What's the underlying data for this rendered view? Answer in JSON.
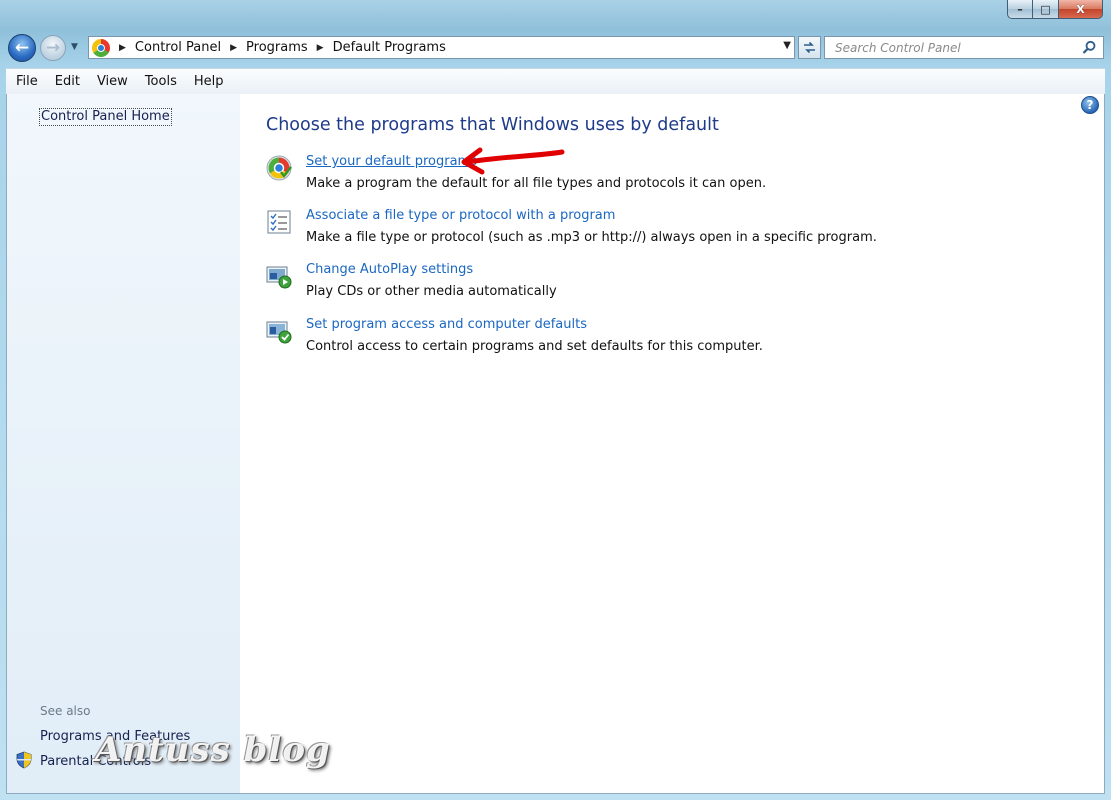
{
  "window": {
    "caption": {
      "minimize": "–",
      "maximize": "□",
      "close": "X"
    }
  },
  "address_bar": {
    "breadcrumbs": [
      "Control Panel",
      "Programs",
      "Default Programs"
    ]
  },
  "search": {
    "placeholder": "Search Control Panel"
  },
  "menu": [
    "File",
    "Edit",
    "View",
    "Tools",
    "Help"
  ],
  "sidebar": {
    "home_link": "Control Panel Home",
    "see_also_label": "See also",
    "links": [
      "Programs and Features",
      "Parental Controls"
    ]
  },
  "main": {
    "heading": "Choose the programs that Windows uses by default",
    "tasks": [
      {
        "icon": "default-programs-icon",
        "link": "Set your default programs",
        "desc": "Make a program the default for all file types and protocols it can open."
      },
      {
        "icon": "file-association-icon",
        "link": "Associate a file type or protocol with a program",
        "desc": "Make a file type or protocol (such as .mp3 or http://) always open in a specific program."
      },
      {
        "icon": "autoplay-icon",
        "link": "Change AutoPlay settings",
        "desc": "Play CDs or other media automatically"
      },
      {
        "icon": "program-access-icon",
        "link": "Set program access and computer defaults",
        "desc": "Control access to certain programs and set defaults for this computer."
      }
    ]
  },
  "watermark": "Antuss blog",
  "colors": {
    "link": "#1a67c2",
    "heading": "#1e3b8a",
    "annotation_arrow": "#e00000"
  }
}
